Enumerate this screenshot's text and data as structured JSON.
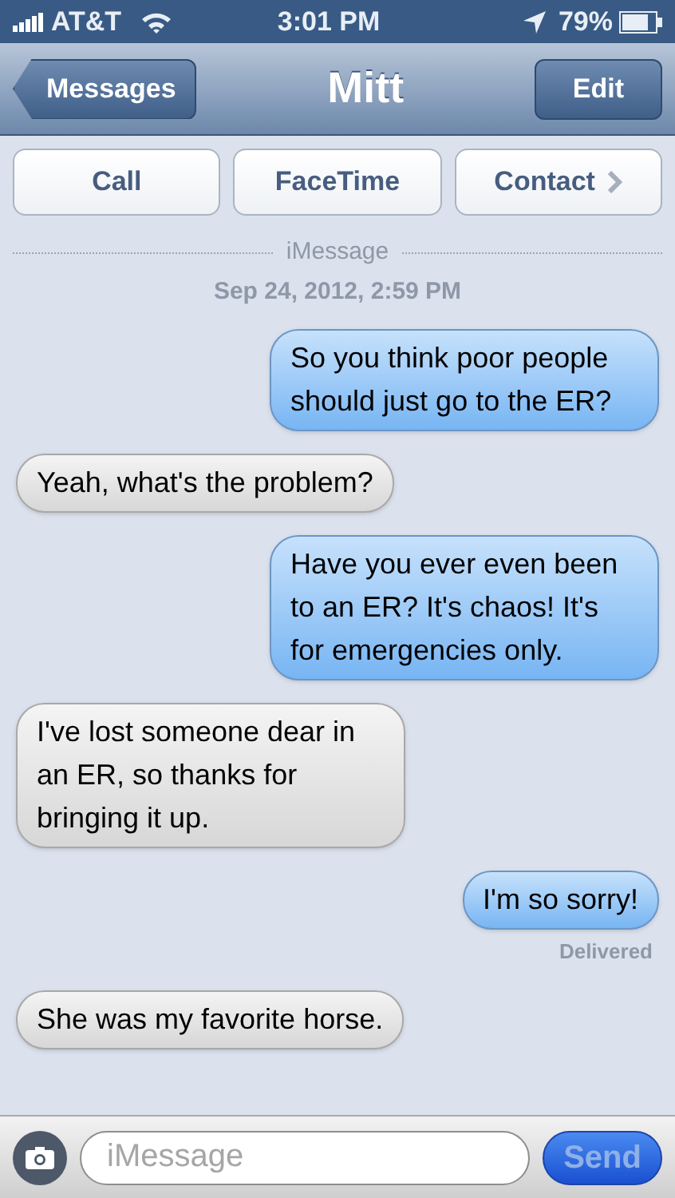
{
  "status_bar": {
    "carrier": "AT&T",
    "time": "3:01 PM",
    "battery": "79%"
  },
  "nav": {
    "back": "Messages",
    "title": "Mitt",
    "edit": "Edit"
  },
  "actions": [
    "Call",
    "FaceTime",
    "Contact"
  ],
  "service": "iMessage",
  "timestamp": "Sep 24, 2012, 2:59 PM",
  "messages": [
    {
      "kind": "sent",
      "text": "So you think poor people should just go to the ER?"
    },
    {
      "kind": "received",
      "text": "Yeah, what's the problem?"
    },
    {
      "kind": "sent",
      "text": "Have you ever even been to an ER? It's chaos! It's for emergencies only."
    },
    {
      "kind": "received",
      "text": "I've lost someone dear in an ER, so thanks for bringing it up."
    },
    {
      "kind": "sent",
      "text": "I'm so sorry!",
      "status": "Delivered"
    },
    {
      "kind": "received",
      "text": "She was my favorite horse."
    }
  ],
  "composer": {
    "placeholder": "iMessage",
    "send": "Send",
    "send_disabled": true
  }
}
